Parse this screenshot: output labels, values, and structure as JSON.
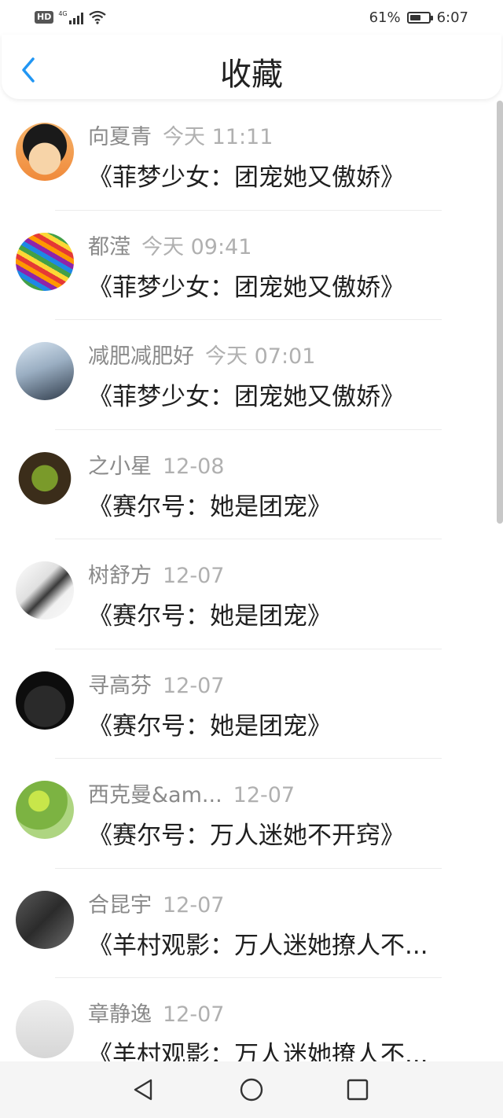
{
  "status_bar": {
    "hd": "HD",
    "network": "4G",
    "battery": "61%",
    "battery_level": 0.61,
    "time": "6:07"
  },
  "header": {
    "title": "收藏",
    "back_icon": "chevron-left-icon",
    "accent_color": "#2196f3"
  },
  "items": [
    {
      "name": "向夏青",
      "time": "今天 11:11",
      "book": "《菲梦少女：团宠她又傲娇》"
    },
    {
      "name": "都滢",
      "time": "今天 09:41",
      "book": "《菲梦少女：团宠她又傲娇》"
    },
    {
      "name": "减肥减肥好",
      "time": "今天 07:01",
      "book": "《菲梦少女：团宠她又傲娇》"
    },
    {
      "name": "之小星",
      "time": "12-08",
      "book": "《赛尔号：她是团宠》"
    },
    {
      "name": "树舒方",
      "time": "12-07",
      "book": "《赛尔号：她是团宠》"
    },
    {
      "name": "寻高芬",
      "time": "12-07",
      "book": "《赛尔号：她是团宠》"
    },
    {
      "name": "西克曼&am...",
      "time": "12-07",
      "book": "《赛尔号：万人迷她不开窍》"
    },
    {
      "name": "合昆宇",
      "time": "12-07",
      "book": "《羊村观影：万人迷她撩人不..."
    },
    {
      "name": "章静逸",
      "time": "12-07",
      "book": "《羊村观影：万人迷她撩人不..."
    }
  ],
  "nav": {
    "back": "back-triangle-icon",
    "home": "home-circle-icon",
    "recents": "recents-square-icon"
  }
}
